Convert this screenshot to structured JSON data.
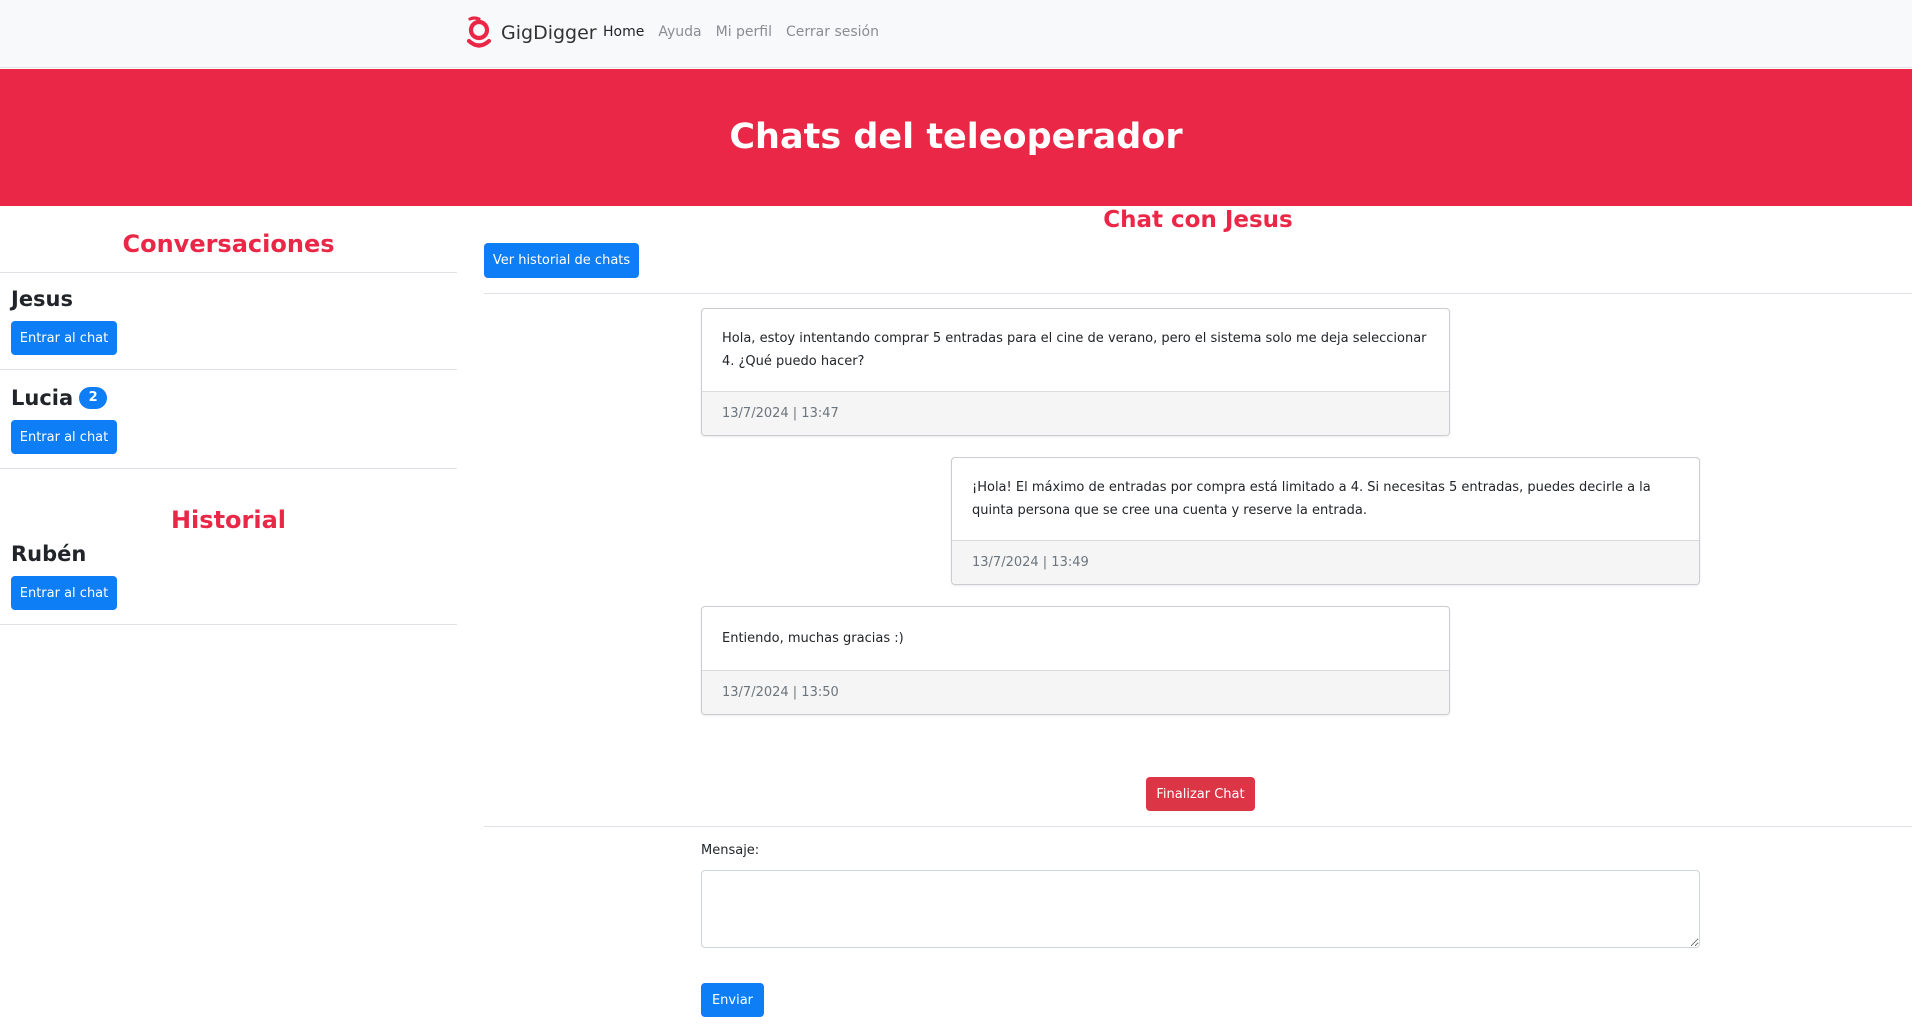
{
  "colors": {
    "brand": "#eb2747",
    "primary": "#0d7ef6",
    "danger": "#dc3545"
  },
  "navbar": {
    "brand_name": "GigDigger",
    "brand_icon": "gigdigger-logo-icon",
    "links": [
      "Home",
      "Ayuda",
      "Mi perfil",
      "Cerrar sesión"
    ],
    "active": "Home"
  },
  "hero": {
    "title": "Chats del teleoperador"
  },
  "sidebar": {
    "conversations_title": "Conversaciones",
    "conversations": [
      {
        "name": "Jesus",
        "badge": "",
        "button": "Entrar al chat"
      },
      {
        "name": "Lucia",
        "badge": "2",
        "button": "Entrar al chat"
      }
    ],
    "history_title": "Historial",
    "history": [
      {
        "name": "Rubén",
        "button": "Entrar al chat"
      }
    ]
  },
  "chat": {
    "title": "Chat con Jesus",
    "history_button": "Ver historial de chats",
    "messages": [
      {
        "text": "Hola, estoy intentando comprar 5 entradas para el cine de verano, pero el sistema solo me deja seleccionar 4. ¿Qué puedo hacer?",
        "time": "13/7/2024 | 13:47",
        "side": "left"
      },
      {
        "text": "¡Hola! El máximo de entradas por compra está limitado a 4. Si necesitas 5 entradas, puedes decirle a la quinta persona que se cree una cuenta y reserve la entrada.",
        "time": "13/7/2024 | 13:49",
        "side": "right"
      },
      {
        "text": "Entiendo, muchas gracias :)",
        "time": "13/7/2024 | 13:50",
        "side": "left"
      }
    ],
    "end_button": "Finalizar Chat",
    "message_label": "Mensaje:",
    "message_value": "",
    "send_button": "Enviar"
  }
}
